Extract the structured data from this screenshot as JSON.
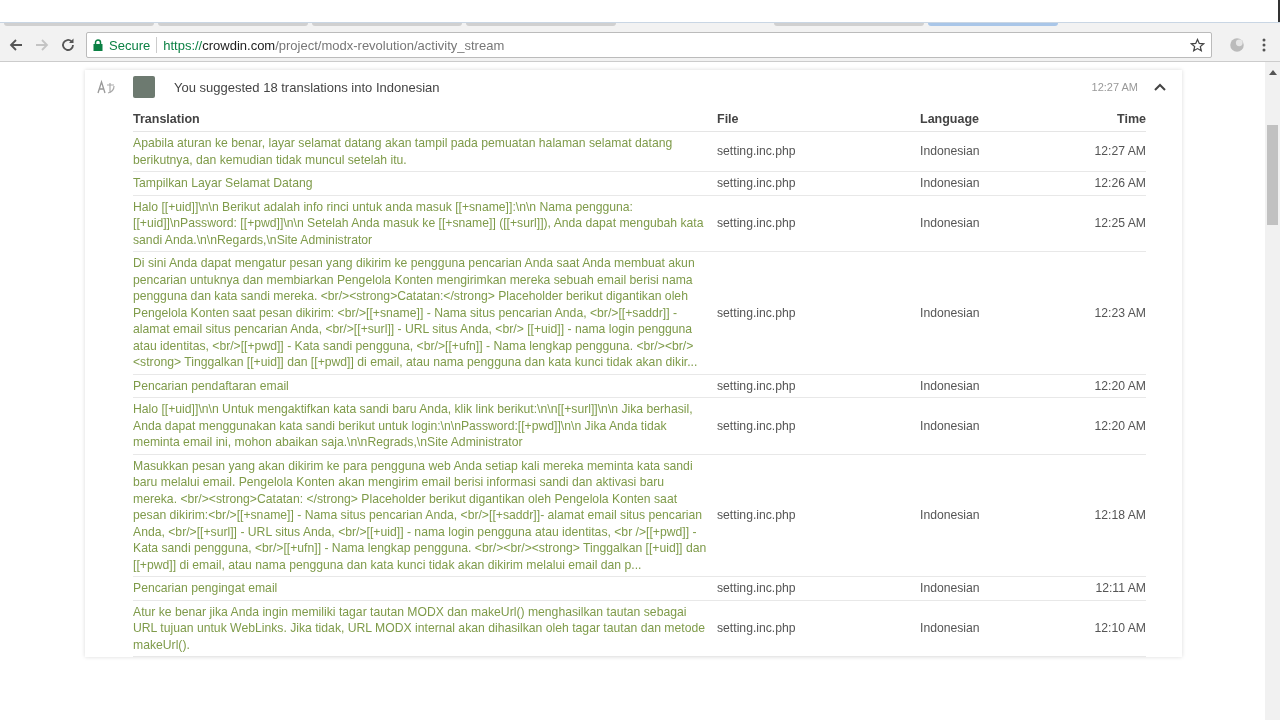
{
  "browser": {
    "tabs": [
      {
        "selected": false
      },
      {
        "selected": false
      },
      {
        "selected": false
      },
      {
        "selected": false
      },
      {
        "selected": false
      },
      {
        "selected": true
      }
    ],
    "security_label": "Secure",
    "url": {
      "scheme": "https://",
      "host": "crowdin.com",
      "path": "/project/modx-revolution/activity_stream"
    }
  },
  "activity": {
    "summary": "You suggested 18 translations into Indonesian",
    "time": "12:27 AM",
    "expanded": true,
    "columns": [
      "Translation",
      "File",
      "Language",
      "Time"
    ],
    "rows": [
      {
        "translation": "Apabila aturan ke benar, layar selamat datang akan tampil pada pemuatan halaman selamat datang berikutnya, dan kemudian tidak muncul setelah itu.",
        "file": "setting.inc.php",
        "language": "Indonesian",
        "time": "12:27 AM"
      },
      {
        "translation": "Tampilkan Layar Selamat Datang",
        "file": "setting.inc.php",
        "language": "Indonesian",
        "time": "12:26 AM"
      },
      {
        "translation": "Halo [[+uid]]\\n\\n Berikut adalah info rinci untuk anda masuk [[+sname]]:\\n\\n Nama pengguna: [[+uid]]\\nPassword: [[+pwd]]\\n\\n Setelah Anda masuk ke [[+sname]] ([[+surl]]), Anda dapat mengubah kata sandi Anda.\\n\\nRegards,\\nSite Administrator",
        "file": "setting.inc.php",
        "language": "Indonesian",
        "time": "12:25 AM"
      },
      {
        "translation": "Di sini Anda dapat mengatur pesan yang dikirim ke pengguna pencarian Anda saat Anda membuat akun pencarian untuknya dan membiarkan Pengelola Konten mengirimkan mereka sebuah email berisi nama pengguna dan kata sandi mereka. <br/><strong>Catatan:</strong> Placeholder berikut digantikan oleh Pengelola Konten saat pesan dikirim: <br/>[[+sname]] - Nama situs pencarian Anda, <br/>[[+saddr]] - alamat email situs pencarian Anda, <br/>[[+surl]] - URL situs Anda, <br/> [[+uid]] - nama login pengguna atau identitas, <br/>[[+pwd]] - Kata sandi pengguna, <br/>[[+ufn]] - Nama lengkap pengguna. <br/><br/><strong> Tinggalkan [[+uid]] dan [[+pwd]] di email, atau nama pengguna dan kata kunci tidak akan dikir...",
        "file": "setting.inc.php",
        "language": "Indonesian",
        "time": "12:23 AM"
      },
      {
        "translation": "Pencarian pendaftaran email",
        "file": "setting.inc.php",
        "language": "Indonesian",
        "time": "12:20 AM"
      },
      {
        "translation": "Halo [[+uid]]\\n\\n Untuk mengaktifkan kata sandi baru Anda, klik link berikut:\\n\\n[[+surl]]\\n\\n Jika berhasil, Anda dapat menggunakan kata sandi berikut untuk login:\\n\\nPassword:[[+pwd]]\\n\\n Jika Anda tidak meminta email ini, mohon abaikan saja.\\n\\nRegrads,\\nSite Administrator",
        "file": "setting.inc.php",
        "language": "Indonesian",
        "time": "12:20 AM"
      },
      {
        "translation": "Masukkan pesan yang akan dikirim ke para pengguna web Anda setiap kali mereka meminta kata sandi baru melalui email. Pengelola Konten akan mengirim email berisi informasi sandi dan aktivasi baru mereka. <br/><strong>Catatan: </strong> Placeholder berikut digantikan oleh Pengelola Konten saat pesan dikirim:<br/>[[+sname]] - Nama situs pencarian Anda, <br/>[[+saddr]]- alamat email situs pencarian Anda, <br/>[[+surl]] - URL situs Anda, <br/>[[+uid]] - nama login pengguna atau identitas, <br />[[+pwd]] - Kata sandi pengguna, <br/>[[+ufn]] - Nama lengkap pengguna. <br/><br/><strong> Tinggalkan [[+uid]] dan [[+pwd]] di email, atau nama pengguna dan kata kunci tidak akan dikirim melalui email dan p...",
        "file": "setting.inc.php",
        "language": "Indonesian",
        "time": "12:18 AM"
      },
      {
        "translation": "Pencarian pengingat email",
        "file": "setting.inc.php",
        "language": "Indonesian",
        "time": "12:11 AM"
      },
      {
        "translation": "Atur ke benar jika Anda ingin memiliki tagar tautan MODX dan makeUrl() menghasilkan tautan sebagai URL tujuan untuk WebLinks. Jika tidak, URL MODX internal akan dihasilkan oleh tagar tautan dan metode makeUrl().",
        "file": "setting.inc.php",
        "language": "Indonesian",
        "time": "12:10 AM"
      }
    ]
  }
}
